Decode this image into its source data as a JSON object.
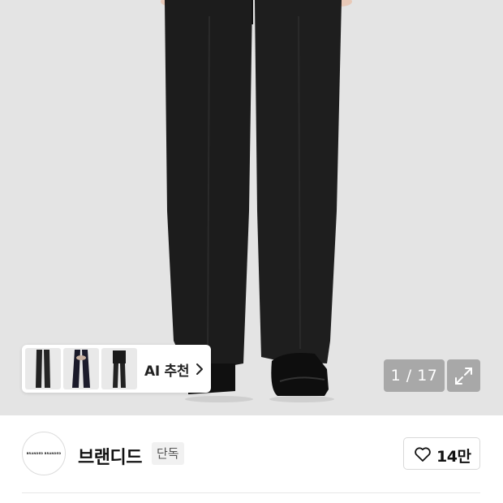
{
  "gallery": {
    "ai_recommend_label": "AI 추천",
    "image_counter": "1 / 17",
    "icons": {
      "chevron": "chevron-right-icon",
      "expand": "expand-icon"
    }
  },
  "brand": {
    "logo_text": "BRANDED BRANDED",
    "name": "브랜디드",
    "badge": "단독",
    "like_count": "14만",
    "like_icon": "heart-icon"
  },
  "colors": {
    "hero_background": "#e4e4e4",
    "pants": "#1c1c1c",
    "counter_overlay": "#828282"
  }
}
